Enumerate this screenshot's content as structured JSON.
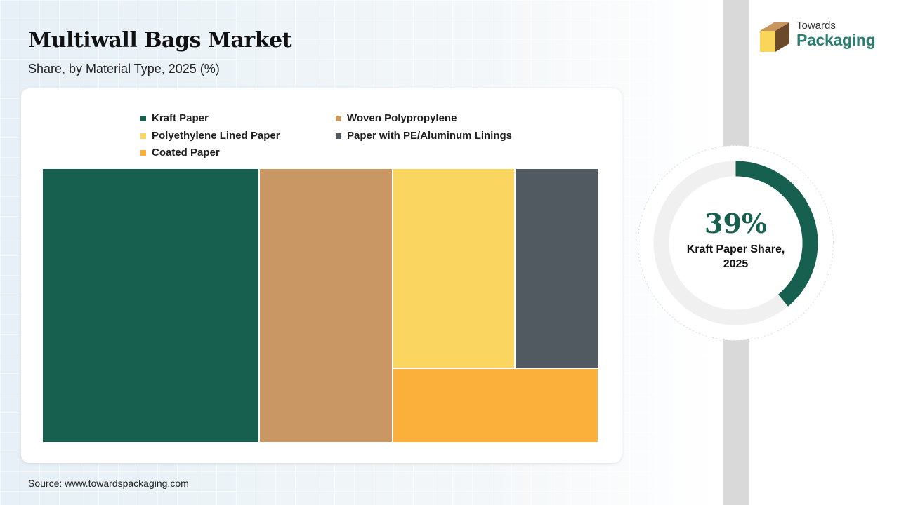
{
  "header": {
    "title": "Multiwall Bags Market",
    "subtitle": "Share, by Material Type, 2025 (%)"
  },
  "logo": {
    "line1": "Towards",
    "line2": "Packaging",
    "icon": "box-logo-icon",
    "colors": {
      "box_top": "#c8955f",
      "box_front": "#f9d55a",
      "box_side": "#6b4a2c",
      "text": "#2a7d6f"
    }
  },
  "chart_data": {
    "type": "treemap",
    "legend_position": "top",
    "series": [
      {
        "name": "Kraft Paper",
        "value": 39,
        "color": "#17604f"
      },
      {
        "name": "Woven Polypropylene",
        "value": 24,
        "color": "#c89763"
      },
      {
        "name": "Polyethylene Lined Paper",
        "value": 16,
        "color": "#fad661"
      },
      {
        "name": "Paper with PE/Aluminum Linings",
        "value": 11,
        "color": "#515961"
      },
      {
        "name": "Coated Paper",
        "value": 10,
        "color": "#fbb03b"
      }
    ]
  },
  "highlight": {
    "value": "39%",
    "label": "Kraft Paper Share, 2025",
    "fraction": 0.39,
    "color": "#17604f",
    "track_color": "#f0f0f0"
  },
  "footer": {
    "source": "Source: www.towardspackaging.com"
  }
}
